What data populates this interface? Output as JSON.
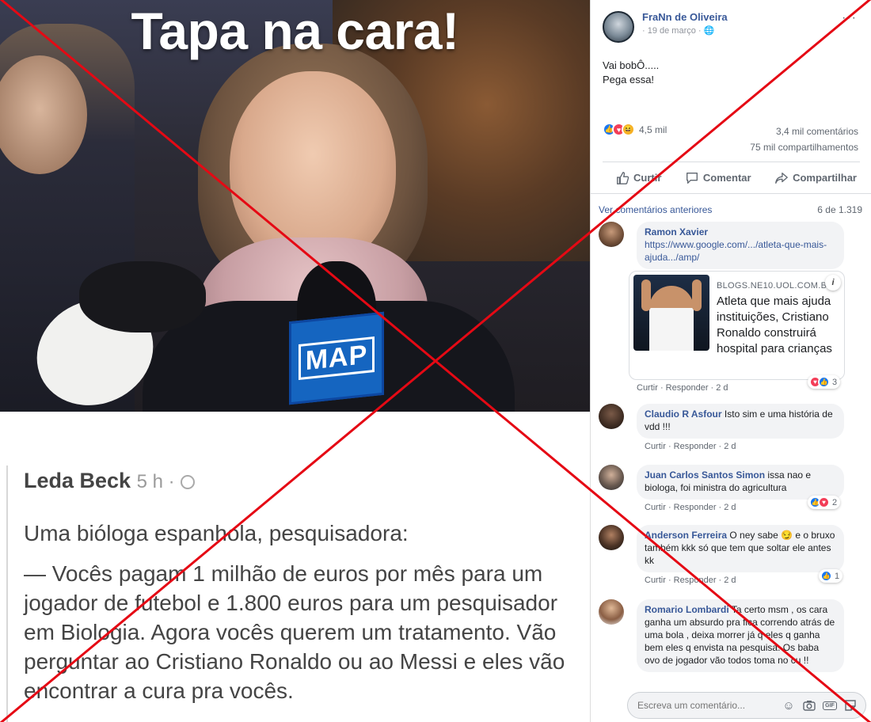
{
  "meme": {
    "headline": "Tapa na cara!",
    "mic_badge": "MAP",
    "post_author": "Leda Beck",
    "post_meta": "5 h ·",
    "post_line1": "Uma bióloga espanhola, pesquisadora:",
    "post_line2": "— Vocês pagam 1 milhão de euros por mês para um jogador de futebol e 1.800 euros para um pesquisador em Biologia. Agora vocês querem um tratamento. Vão perguntar ao Cristiano Ronaldo ou ao Messi e eles vão encontrar a cura pra vocês."
  },
  "post": {
    "author": "FraNn de Oliveira",
    "date": "· 19 de março ·",
    "more": "···",
    "text_line1": "Vai bobÔ.....",
    "text_line2": "Pega essa!",
    "reactions_count": "4,5 mil",
    "comments_count": "3,4 mil comentários",
    "shares_count": "75 mil compartilhamentos"
  },
  "actions": {
    "like": "Curtir",
    "comment": "Comentar",
    "share": "Compartilhar"
  },
  "comments_header": {
    "previous": "Ver comentários anteriores",
    "count": "6 de 1.319"
  },
  "comments": [
    {
      "name": "Ramon Xavier",
      "text": "https://www.google.com/.../atleta-que-mais-ajuda.../amp/",
      "meta": "Curtir · Responder · 2 d",
      "reactions": "3"
    },
    {
      "name": "Claudio R Asfour",
      "text": "Isto sim e uma história de vdd !!!",
      "meta": "Curtir · Responder · 2 d"
    },
    {
      "name": "Juan Carlos Santos Simon",
      "text": "issa nao e biologa, foi ministra do agricultura",
      "meta": "Curtir · Responder · 2 d",
      "reactions": "2"
    },
    {
      "name": "Anderson Ferreira",
      "text": "O ney sabe 😏 e o bruxo também kkk só que tem que soltar ele antes kk",
      "meta": "Curtir · Responder · 2 d",
      "reactions": "1"
    },
    {
      "name": "Romario Lombardi",
      "text": "Ta certo msm , os cara ganha um absurdo pra fica correndo atrás de uma bola , deixa morrer já q eles q ganha bem eles q envista na pesquisa. Os baba ovo de jogador vão todos toma no cu !!"
    }
  ],
  "link_card": {
    "source": "BLOGS.NE10.UOL.COM.BR",
    "title": "Atleta que mais ajuda instituições, Cristiano Ronaldo construirá hospital para crianças",
    "info": "i"
  },
  "composer": {
    "placeholder": "Escreva um comentário..."
  },
  "colors": {
    "link_blue": "#385898",
    "cross_red": "#e50914",
    "like_blue": "#1877f2",
    "love_red": "#f33e58",
    "haha_yellow": "#f7b125"
  }
}
